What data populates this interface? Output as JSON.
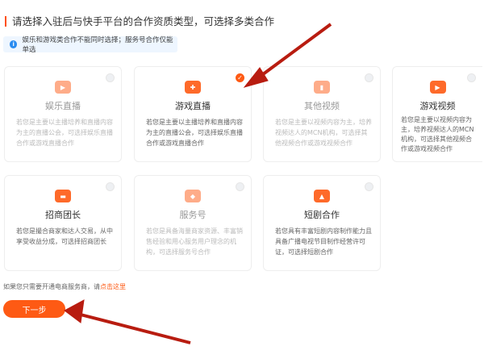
{
  "title": "请选择入驻后与快手平台的合作资质类型，可选择多类合作",
  "notice": "娱乐和游戏类合作不能同时选择；服务号合作仅能单选",
  "cards": [
    {
      "name": "娱乐直播",
      "desc": "若您是主要以主播培养和直播内容为主的直播公会，可选择娱乐直播合作或游戏直播合作",
      "selected": false,
      "disabled": true,
      "icon": "play-icon"
    },
    {
      "name": "游戏直播",
      "desc": "若您是主要以主播培养和直播内容为主的直播公会，可选择娱乐直播合作或游戏直播合作",
      "selected": true,
      "disabled": false,
      "icon": "gamepad-icon"
    },
    {
      "name": "其他视频",
      "desc": "若您是主要以视频内容为主，培养视频达人的MCN机构，可选择其他视频合作或游戏视频合作",
      "selected": false,
      "disabled": true,
      "icon": "video-icon"
    },
    {
      "name": "游戏视频",
      "desc": "若您是主要以视频内容为主，培养视频达人的MCN机构，可选择其他视频合作或游戏视频合作",
      "selected": false,
      "disabled": false,
      "icon": "video-play-icon"
    },
    {
      "name": "招商团长",
      "desc": "若您是撮合商家和达人交易，从中享受收益分成，可选择招商团长",
      "selected": false,
      "disabled": false,
      "icon": "flag-icon"
    },
    {
      "name": "服务号",
      "desc": "若您是具备海量商家资源、丰富销售经验和用心服务用户理念的机构，可选择服务号合作",
      "selected": false,
      "disabled": true,
      "icon": "heart-icon"
    },
    {
      "name": "短剧合作",
      "desc": "若您具有丰富短剧内容制作能力且具备广播电视节目制作经营许可证，可选择短剧合作",
      "selected": false,
      "disabled": false,
      "icon": "screen-icon"
    }
  ],
  "footnote": {
    "text": "如果您只需要开通电商服务商，请",
    "link": "点击这里"
  },
  "next_label": "下一步",
  "colors": {
    "accent": "#fe5a14",
    "arrow": "#b81c10"
  }
}
